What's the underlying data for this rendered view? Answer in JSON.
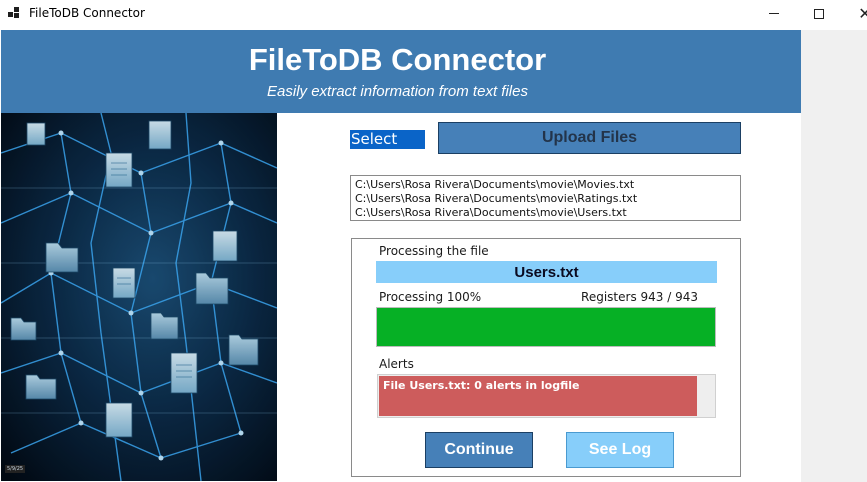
{
  "window": {
    "title": "FileToDB Connector",
    "close_glyph": "✕"
  },
  "header": {
    "title": "FileToDB Connector",
    "subtitle": "Easily extract information from text files"
  },
  "picture": {
    "tag": "5/9/25"
  },
  "upload": {
    "select_label": "Select files",
    "upload_button": "Upload Files"
  },
  "files": [
    "C:\\Users\\Rosa Rivera\\Documents\\movie\\Movies.txt",
    "C:\\Users\\Rosa Rivera\\Documents\\movie\\Ratings.txt",
    "C:\\Users\\Rosa Rivera\\Documents\\movie\\Users.txt"
  ],
  "processing": {
    "label": "Processing the file",
    "current_file": "Users.txt",
    "progress_text": "Processing  100%",
    "registers_text": "Registers 943 / 943",
    "progress_fraction": 1.0
  },
  "alerts": {
    "label": "Alerts",
    "items": [
      "File Users.txt: 0 alerts in logfile"
    ]
  },
  "actions": {
    "continue": "Continue",
    "see_log": "See Log"
  },
  "colors": {
    "header_blue": "#3f7bb1",
    "button_blue": "#4680b8",
    "light_blue": "#87cefa",
    "progress_green": "#06b025",
    "alert_red": "#cd5c5c"
  }
}
